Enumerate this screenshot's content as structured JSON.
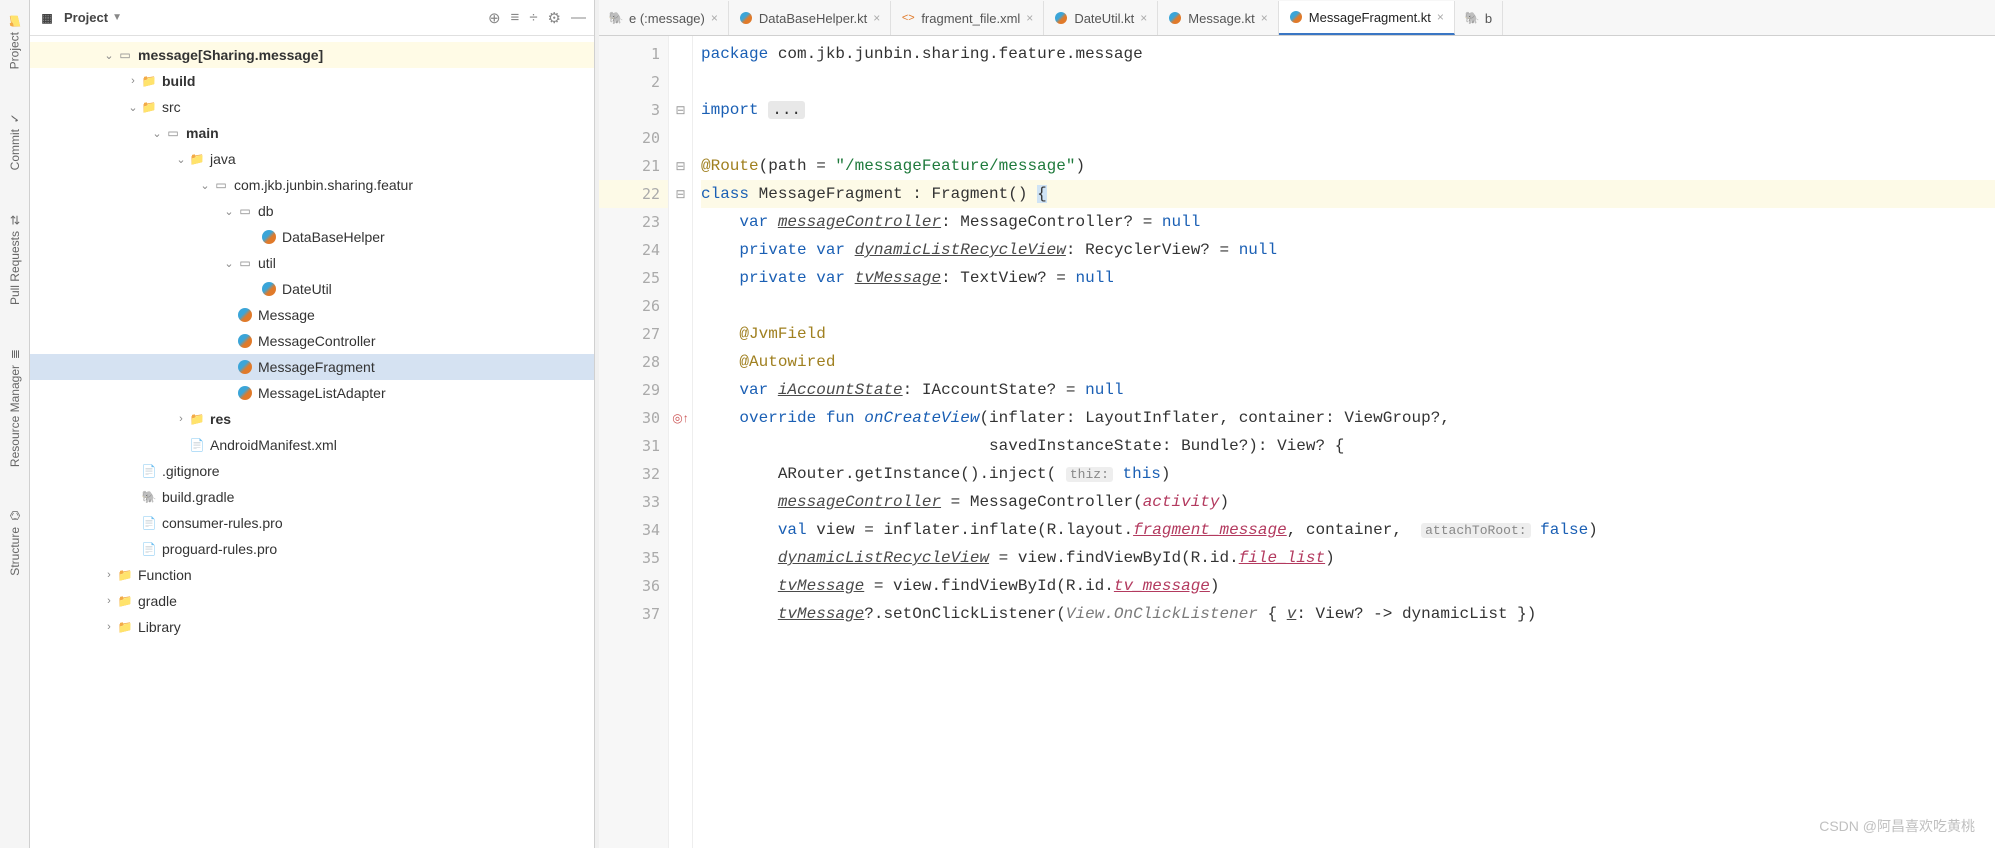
{
  "side_tools": [
    {
      "label": "Project",
      "icon": "📁"
    },
    {
      "label": "Commit",
      "icon": "✓"
    },
    {
      "label": "Pull Requests",
      "icon": "⇄"
    },
    {
      "label": "Resource Manager",
      "icon": "≣"
    },
    {
      "label": "Structure",
      "icon": "⌬"
    }
  ],
  "panel": {
    "title": "Project",
    "toolbar_icons": [
      "⊕",
      "≡",
      "÷",
      "⚙",
      "—"
    ]
  },
  "tree": [
    {
      "d": 3,
      "a": "v",
      "ic": "pkg",
      "t": "message",
      "suffix": " [Sharing.message]",
      "bold": true,
      "hl": true
    },
    {
      "d": 4,
      "a": ">",
      "ic": "folder-blue",
      "t": "build",
      "bold": true
    },
    {
      "d": 4,
      "a": "v",
      "ic": "folder",
      "t": "src"
    },
    {
      "d": 5,
      "a": "v",
      "ic": "pkg",
      "t": "main",
      "bold": true
    },
    {
      "d": 6,
      "a": "v",
      "ic": "folder-blue",
      "t": "java"
    },
    {
      "d": 7,
      "a": "v",
      "ic": "pkg",
      "t": "com.jkb.junbin.sharing.featur"
    },
    {
      "d": 8,
      "a": "v",
      "ic": "pkg",
      "t": "db"
    },
    {
      "d": 9,
      "a": "",
      "ic": "kt",
      "t": "DataBaseHelper"
    },
    {
      "d": 8,
      "a": "v",
      "ic": "pkg",
      "t": "util"
    },
    {
      "d": 9,
      "a": "",
      "ic": "kt",
      "t": "DateUtil"
    },
    {
      "d": 8,
      "a": "",
      "ic": "kt",
      "t": "Message"
    },
    {
      "d": 8,
      "a": "",
      "ic": "kt",
      "t": "MessageController"
    },
    {
      "d": 8,
      "a": "",
      "ic": "kt",
      "t": "MessageFragment",
      "sel": true
    },
    {
      "d": 8,
      "a": "",
      "ic": "kt",
      "t": "MessageListAdapter"
    },
    {
      "d": 6,
      "a": ">",
      "ic": "folder",
      "t": "res",
      "bold": true
    },
    {
      "d": 6,
      "a": "",
      "ic": "xml",
      "t": "AndroidManifest.xml"
    },
    {
      "d": 4,
      "a": "",
      "ic": "file",
      "t": ".gitignore"
    },
    {
      "d": 4,
      "a": "",
      "ic": "gradle",
      "t": "build.gradle"
    },
    {
      "d": 4,
      "a": "",
      "ic": "file",
      "t": "consumer-rules.pro"
    },
    {
      "d": 4,
      "a": "",
      "ic": "file",
      "t": "proguard-rules.pro"
    },
    {
      "d": 3,
      "a": ">",
      "ic": "folder",
      "t": "Function"
    },
    {
      "d": 3,
      "a": ">",
      "ic": "folder",
      "t": "gradle"
    },
    {
      "d": 3,
      "a": ">",
      "ic": "folder",
      "t": "Library"
    }
  ],
  "tabs": [
    {
      "label": "e (:message)",
      "ic": "g",
      "active": false
    },
    {
      "label": "DataBaseHelper.kt",
      "ic": "kt",
      "active": false
    },
    {
      "label": "fragment_file.xml",
      "ic": "xml",
      "active": false
    },
    {
      "label": "DateUtil.kt",
      "ic": "kt",
      "active": false
    },
    {
      "label": "Message.kt",
      "ic": "kt",
      "active": false
    },
    {
      "label": "MessageFragment.kt",
      "ic": "kt",
      "active": true
    },
    {
      "label": "b",
      "ic": "g",
      "active": false,
      "noclose": true
    }
  ],
  "line_numbers": [
    "1",
    "2",
    "3",
    "20",
    "21",
    "22",
    "23",
    "24",
    "25",
    "26",
    "27",
    "28",
    "29",
    "30",
    "31",
    "32",
    "33",
    "34",
    "35",
    "36",
    "37"
  ],
  "current_line_index": 5,
  "gutter_marks": {
    "2": "⊟",
    "4": "⊟",
    "5": "⊟ tbl",
    "13": "◎↑"
  },
  "code_lines": [
    [
      {
        "c": "kw",
        "t": "package"
      },
      {
        "t": " com.jkb.junbin.sharing.feature.message"
      }
    ],
    [],
    [
      {
        "c": "kw",
        "t": "import"
      },
      {
        "t": " "
      },
      {
        "c": "fold",
        "t": "..."
      }
    ],
    [],
    [
      {
        "c": "ann",
        "t": "@Route"
      },
      {
        "t": "(path = "
      },
      {
        "c": "str",
        "t": "\"/messageFeature/message\""
      },
      {
        "t": ")"
      }
    ],
    [
      {
        "c": "kw",
        "t": "class"
      },
      {
        "t": " MessageFragment : Fragment() "
      },
      {
        "c": "caret",
        "t": "{"
      }
    ],
    [
      {
        "t": "    "
      },
      {
        "c": "kw",
        "t": "var"
      },
      {
        "t": " "
      },
      {
        "c": "uvar",
        "t": "messageController"
      },
      {
        "t": ": MessageController? = "
      },
      {
        "c": "kw",
        "t": "null"
      }
    ],
    [
      {
        "t": "    "
      },
      {
        "c": "kw",
        "t": "private var"
      },
      {
        "t": " "
      },
      {
        "c": "uvar",
        "t": "dynamicListRecycleView"
      },
      {
        "t": ": RecyclerView? = "
      },
      {
        "c": "kw",
        "t": "null"
      }
    ],
    [
      {
        "t": "    "
      },
      {
        "c": "kw",
        "t": "private var"
      },
      {
        "t": " "
      },
      {
        "c": "uvar",
        "t": "tvMessage"
      },
      {
        "t": ": TextView? = "
      },
      {
        "c": "kw",
        "t": "null"
      }
    ],
    [],
    [
      {
        "t": "    "
      },
      {
        "c": "ann",
        "t": "@JvmField"
      }
    ],
    [
      {
        "t": "    "
      },
      {
        "c": "ann",
        "t": "@Autowired"
      }
    ],
    [
      {
        "t": "    "
      },
      {
        "c": "kw",
        "t": "var"
      },
      {
        "t": " "
      },
      {
        "c": "uvar",
        "t": "iAccountState"
      },
      {
        "t": ": IAccountState? = "
      },
      {
        "c": "kw",
        "t": "null"
      }
    ],
    [
      {
        "t": "    "
      },
      {
        "c": "kw",
        "t": "override fun"
      },
      {
        "t": " "
      },
      {
        "c": "fn",
        "t": "onCreateView"
      },
      {
        "t": "(inflater: LayoutInflater, container: ViewGroup?,"
      }
    ],
    [
      {
        "t": "                              savedInstanceState: Bundle?): View? {"
      }
    ],
    [
      {
        "t": "        ARouter.getInstance().inject( "
      },
      {
        "c": "hint",
        "t": "thiz:"
      },
      {
        "t": " "
      },
      {
        "c": "thisk",
        "t": "this"
      },
      {
        "t": ")"
      }
    ],
    [
      {
        "t": "        "
      },
      {
        "c": "uvar",
        "t": "messageController"
      },
      {
        "t": " = MessageController("
      },
      {
        "c": "refid",
        "t": "activity"
      },
      {
        "t": ")"
      }
    ],
    [
      {
        "t": "        "
      },
      {
        "c": "kw",
        "t": "val"
      },
      {
        "t": " view = inflater.inflate(R.layout."
      },
      {
        "c": "refprop",
        "t": "fragment_message"
      },
      {
        "t": ", container,  "
      },
      {
        "c": "hint",
        "t": "attachToRoot:"
      },
      {
        "t": " "
      },
      {
        "c": "kw",
        "t": "false"
      },
      {
        "t": ")"
      }
    ],
    [
      {
        "t": "        "
      },
      {
        "c": "uvar",
        "t": "dynamicListRecycleView"
      },
      {
        "t": " = view.findViewById(R.id."
      },
      {
        "c": "refprop",
        "t": "file_list"
      },
      {
        "t": ")"
      }
    ],
    [
      {
        "t": "        "
      },
      {
        "c": "uvar",
        "t": "tvMessage"
      },
      {
        "t": " = view.findViewById(R.id."
      },
      {
        "c": "refprop",
        "t": "tv_message"
      },
      {
        "t": ")"
      }
    ],
    [
      {
        "t": "        "
      },
      {
        "c": "uvar",
        "t": "tvMessage"
      },
      {
        "t": "?.setOnClickListener("
      },
      {
        "c": "param",
        "t": "View.OnClickListener "
      },
      {
        "t": "{ "
      },
      {
        "c": "uvar",
        "t": "v"
      },
      {
        "t": ": View? -> dynamicList })"
      }
    ]
  ],
  "watermark": "CSDN @阿昌喜欢吃黄桃"
}
